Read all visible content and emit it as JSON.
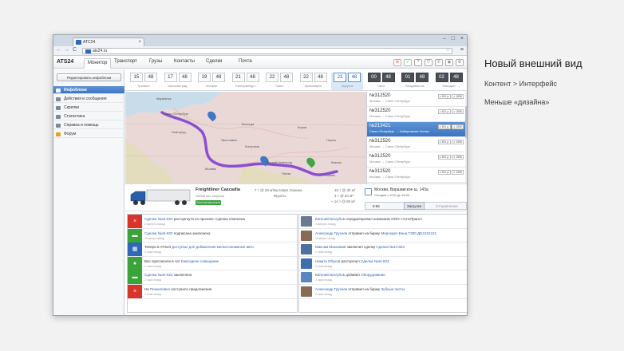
{
  "browser": {
    "tab_title": "ATC24",
    "url": "ats24.ru",
    "nav_back": "←",
    "nav_forward": "→",
    "nav_reload": "C",
    "menu": "≡",
    "win_min": "–",
    "win_max": "□",
    "win_close": "×",
    "tab_close": "×"
  },
  "app": {
    "logo": "ATS24",
    "tabs": [
      "Монитор",
      "Транспорт",
      "Грузы",
      "Контакты",
      "Сделки",
      "Почта"
    ],
    "active_tab": "Монитор"
  },
  "sidebar": {
    "button": "Редактировать инфоблоки",
    "items": [
      {
        "label": "Инфоблоки",
        "active": true,
        "icon": "info-icon"
      },
      {
        "label": "Действия и сообщения",
        "active": false,
        "icon": "message-icon"
      },
      {
        "label": "Скрепки",
        "active": false,
        "icon": "clip-icon"
      },
      {
        "label": "Статистика",
        "active": false,
        "icon": "chart-icon"
      },
      {
        "label": "Справка и помощь",
        "active": false,
        "icon": "help-icon"
      },
      {
        "label": "Форум",
        "active": false,
        "icon": "forum-icon"
      }
    ]
  },
  "clocks": [
    {
      "h": "15",
      "m": "48",
      "city": "Гринвич"
    },
    {
      "h": "17",
      "m": "48",
      "city": "Калининград"
    },
    {
      "h": "19",
      "m": "48",
      "city": "Москва"
    },
    {
      "h": "21",
      "m": "48",
      "city": "Екатеринбург"
    },
    {
      "h": "22",
      "m": "48",
      "city": "Омск"
    },
    {
      "h": "22",
      "m": "48",
      "city": "Красноярск"
    },
    {
      "h": "23",
      "m": "48",
      "city": "Иркутск",
      "current": true
    },
    {
      "h": "00",
      "m": "48",
      "city": "Чита",
      "dark": true
    },
    {
      "h": "01",
      "m": "48",
      "city": "Владивосток",
      "dark": true
    },
    {
      "h": "02",
      "m": "48",
      "city": "Магадан",
      "dark": true
    }
  ],
  "map_labels": [
    "Санкт-Петербург",
    "Мурманск",
    "Новгород",
    "Москва",
    "Ярославль",
    "Кострома",
    "Нижний Новгород",
    "Пенза",
    "Рязань",
    "Киров",
    "Пермь",
    "Уфа",
    "Казань",
    "Самара",
    "Вологда",
    "Екатеринбург"
  ],
  "orders": [
    {
      "no": "№312520",
      "route": "Москва → Санкт-Петербург",
      "p1": "≥ 501 р.",
      "p2": "≥ 1556",
      "sel": false
    },
    {
      "no": "№312520",
      "route": "Москва → Санкт-Петербург",
      "p1": "≥ 501 р.",
      "p2": "≥ 1556",
      "sel": false
    },
    {
      "no": "№213421",
      "route": "Санкт-Петербург → Набережные Челны",
      "p1": "≥ 501 р.",
      "p2": "≥ 1556",
      "sel": true
    },
    {
      "no": "№312520",
      "route": "Москва → Санкт-Петербург",
      "p1": "≥ 501 р.",
      "p2": "≥ 1556",
      "sel": false
    },
    {
      "no": "№312520",
      "route": "Москва → Санкт-Петербург",
      "p1": "≥ 501 р.",
      "p2": "≥ 1556",
      "sel": false
    },
    {
      "no": "№312520",
      "route": "Москва → Санкт-Петербург",
      "p1": "≥ 501 р.",
      "p2": "≥ 1556",
      "sel": false
    }
  ],
  "truck": {
    "name": "Freightliner Cascadia",
    "sub": "любой вес загрузки",
    "badge": "Бесплатная плата",
    "spec1": "7 т @ 20 м³",
    "spec2": "Бытовая техника",
    "spec3": "Фрукты",
    "vol1": "15 т @ 40 м³",
    "vol2": "4 т @ 20 м³",
    "vol3": "≈ 14 т @ 60 м³"
  },
  "destination": {
    "address": "Москва, Варшавское ш. 143а",
    "date": "Сегодня с 9:00 до 18:00",
    "time": "8:55",
    "stage": "Загрузка",
    "next": "Отправление"
  },
  "feed_left": [
    {
      "link": "Сделка №44-823",
      "text": " расторгнута по причине: Сделка отменена",
      "time": "2 минуты назад",
      "color": "#d9342b",
      "icon": "×"
    },
    {
      "link": "Сделка №44-823",
      "text": " подписана заключена",
      "time": "15 минут назад",
      "color": "#3aa33a",
      "icon": "▬"
    },
    {
      "link": "доступны для добавления мелкотоннажные авто",
      "pre": "Теперь в ATS24 ",
      "text": "",
      "time": "2 часа назад",
      "color": "#2e68b7",
      "icon": "▦"
    },
    {
      "link": "Ежегодное совещание",
      "pre": "Вас пригласили в чат ",
      "text": "",
      "time": "2 часа назад",
      "color": "#3aa33a",
      "icon": "●"
    },
    {
      "link": "Сделка №44-823",
      "text": " заключена",
      "time": "2 часа назад",
      "color": "#3aa33a",
      "icon": "▬"
    },
    {
      "link": "Пенкилевич",
      "pre": "На ",
      "text": " поступило предложение",
      "time": "2 часа назад",
      "color": "#d9342b",
      "icon": "×"
    }
  ],
  "feed_right": [
    {
      "who": "Евгений Безгубов",
      "text": " отредактировал компанию ООО «АлтиТранс»",
      "time": "2 минуты назад",
      "av": "#6a7a90"
    },
    {
      "who": "Александр Грузнев",
      "text": " отправил на биржу ",
      "link": "Мерседес-Бенц T300 ДЕ1234123",
      "time": "15 минут назад",
      "av": "#8a6a55"
    },
    {
      "who": "Максим Максимов",
      "text": " заключил сделку ",
      "link": "Сделка №44-823",
      "time": "2 часа назад",
      "av": "#4d6fa1"
    },
    {
      "who": "Никита Обухов",
      "text": " расторгнул ",
      "link": "Сделка №44-823",
      "time": "2 часа назад",
      "av": "#3d6fb0"
    },
    {
      "who": "Евгений Безгубов",
      "text": " добавил ",
      "link": "Оборудование",
      "time": "2 часа назад",
      "av": "#5b86bf"
    },
    {
      "who": "Александр Грузнев",
      "text": " отправил на биржу ",
      "link": "Зубные пасты",
      "time": "2 часа назад",
      "av": "#8a6a55"
    }
  ],
  "slide": {
    "title": "Новый внешний вид",
    "line1": "Контент > Интерфейс",
    "line2": "Меньше «дизайна»"
  }
}
